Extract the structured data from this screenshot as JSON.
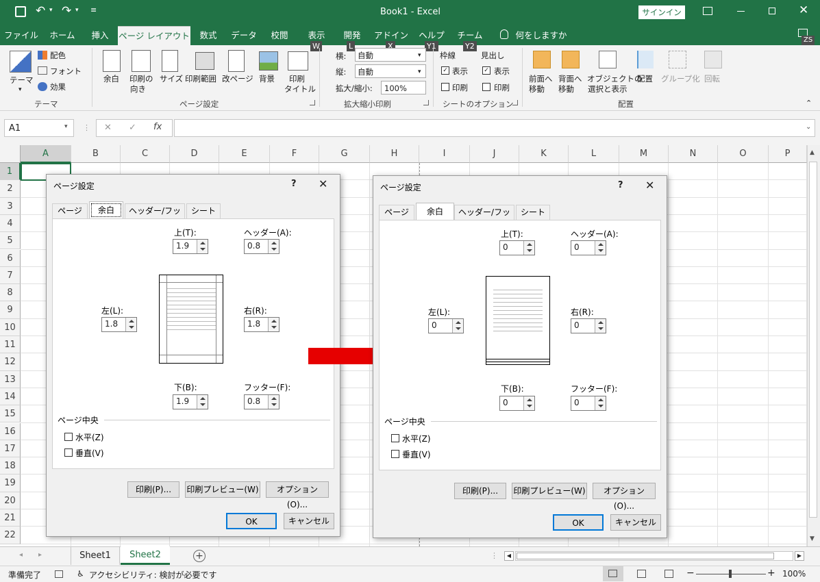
{
  "titlebar": {
    "file_title": "Book1 - Excel",
    "signin": "サインイン",
    "ribbon_icon": "ribbon-display-icon"
  },
  "tabs": [
    {
      "label": "ファイル"
    },
    {
      "label": "ホーム"
    },
    {
      "label": "挿入"
    },
    {
      "label": "ページ レイアウト",
      "active": true
    },
    {
      "label": "数式"
    },
    {
      "label": "データ"
    },
    {
      "label": "校閲"
    },
    {
      "label": "表示"
    },
    {
      "label": "開発"
    },
    {
      "label": "アドイン"
    },
    {
      "label": "ヘルプ"
    },
    {
      "label": "チーム"
    }
  ],
  "tell_me": "何をしますか",
  "user_initials": "ZS",
  "keytips": [
    "W",
    "L",
    "X",
    "Y1",
    "Y2"
  ],
  "ribbon": {
    "theme": {
      "themes": "テーマ",
      "colors": "配色",
      "fonts": "フォント",
      "effects": "効果",
      "group": "テーマ"
    },
    "page_setup": {
      "margins": "余白",
      "orientation1": "印刷の",
      "orientation2": "向き",
      "size": "サイズ",
      "print_area": "印刷範囲",
      "breaks": "改ページ",
      "background": "背景",
      "titles1": "印刷",
      "titles2": "タイトル",
      "group": "ページ設定"
    },
    "scale": {
      "width": "横:",
      "width_val": "自動",
      "height": "縦:",
      "height_val": "自動",
      "scale": "拡大/縮小:",
      "scale_val": "100%",
      "group": "拡大縮小印刷"
    },
    "sheet_opts": {
      "gridlines": "枠線",
      "headings": "見出し",
      "view1": "表示",
      "view2": "表示",
      "print1": "印刷",
      "print2": "印刷",
      "group": "シートのオプション"
    },
    "arrange": {
      "fwd1": "前面へ",
      "fwd2": "移動",
      "back1": "背面へ",
      "back2": "移動",
      "sel1": "オブジェクトの",
      "sel2": "選択と表示",
      "align": "配置",
      "group_btn": "グループ化",
      "rotate": "回転",
      "group": "配置"
    }
  },
  "formula": {
    "namebox": "A1",
    "fx": "fx",
    "x": "✕",
    "check": "✓"
  },
  "columns": [
    "A",
    "B",
    "C",
    "D",
    "E",
    "F",
    "G",
    "H",
    "I",
    "J",
    "K",
    "L",
    "M",
    "N",
    "O",
    "P"
  ],
  "rows": [
    "1",
    "2",
    "3",
    "4",
    "5",
    "6",
    "7",
    "8",
    "9",
    "10",
    "11",
    "12",
    "13",
    "14",
    "15",
    "16",
    "17",
    "18",
    "19",
    "20",
    "21",
    "22"
  ],
  "sheets": [
    "Sheet1",
    "Sheet2"
  ],
  "status": {
    "ready": "準備完了",
    "accessibility": "アクセシビリティ: 検討が必要です",
    "zoom": "100%"
  },
  "dialog_left": {
    "title": "ページ設定",
    "help": "?",
    "close": "✕",
    "tabs": [
      "ページ",
      "余白",
      "ヘッダー/フッター",
      "シート"
    ],
    "top_label": "上(T):",
    "top": "1.9",
    "header_label": "ヘッダー(A):",
    "header": "0.8",
    "left_label": "左(L):",
    "left": "1.8",
    "right_label": "右(R):",
    "right": "1.8",
    "bottom_label": "下(B):",
    "bottom": "1.9",
    "footer_label": "フッター(F):",
    "footer": "0.8",
    "center": "ページ中央",
    "horiz": "水平(Z)",
    "vert": "垂直(V)",
    "print": "印刷(P)...",
    "preview": "印刷プレビュー(W)",
    "options": "オプション(O)...",
    "ok": "OK",
    "cancel": "キャンセル"
  },
  "dialog_right": {
    "title": "ページ設定",
    "help": "?",
    "close": "✕",
    "tabs": [
      "ページ",
      "余白",
      "ヘッダー/フッター",
      "シート"
    ],
    "top_label": "上(T):",
    "top": "0",
    "header_label": "ヘッダー(A):",
    "header": "0",
    "left_label": "左(L):",
    "left": "0",
    "right_label": "右(R):",
    "right": "0",
    "bottom_label": "下(B):",
    "bottom": "0",
    "footer_label": "フッター(F):",
    "footer": "0",
    "center": "ページ中央",
    "horiz": "水平(Z)",
    "vert": "垂直(V)",
    "print": "印刷(P)...",
    "preview": "印刷プレビュー(W)",
    "options": "オプション(O)...",
    "ok": "OK",
    "cancel": "キャンセル"
  },
  "arrow_color": "#e60000",
  "accent": "#217346"
}
